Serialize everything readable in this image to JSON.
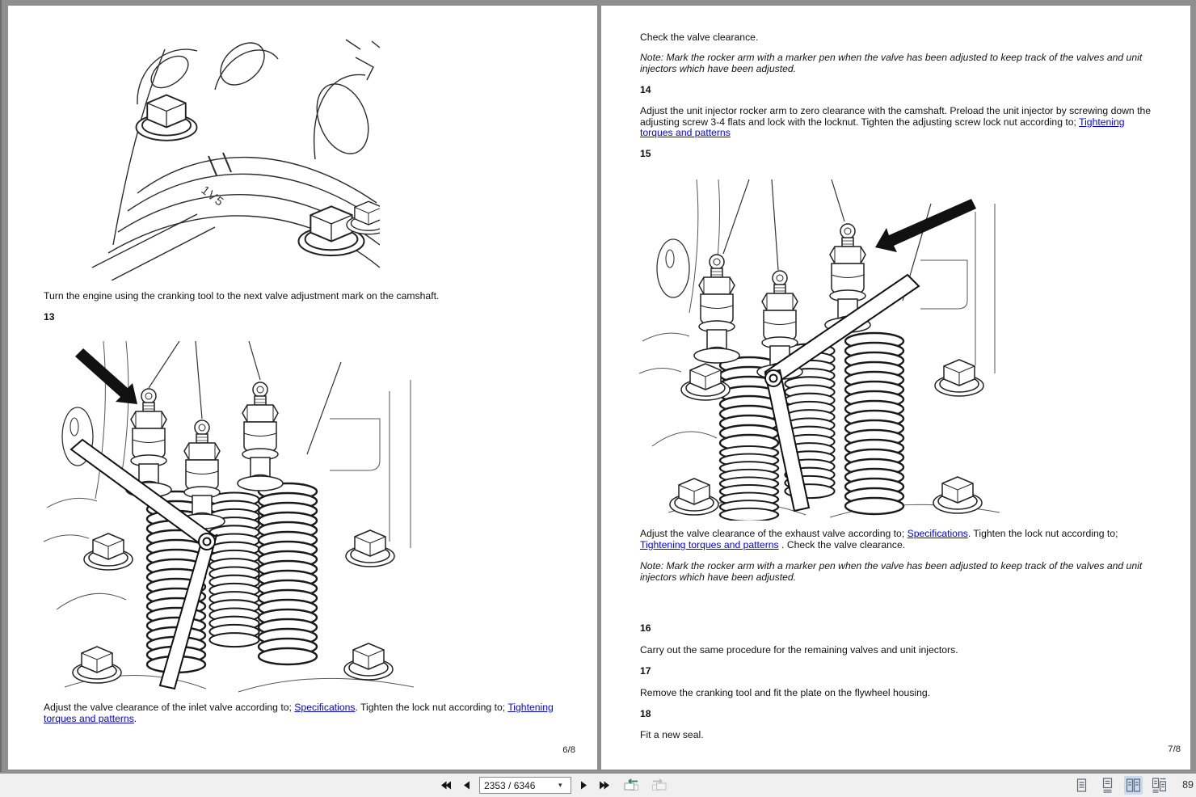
{
  "left_page": {
    "illustration_camshaft": {
      "mark_label": "1V5"
    },
    "para_turn_engine": "Turn the engine using the cranking tool to the next valve adjustment mark on the camshaft.",
    "step_13": "13",
    "para_adjust": {
      "prefix": "Adjust the valve clearance of the inlet valve according to; ",
      "link_specifications": "Specifications",
      "mid": ". Tighten the lock nut according to; ",
      "link_tightening": "Tightening torques and patterns",
      "suffix": "."
    },
    "page_number": "6/8"
  },
  "right_page": {
    "para_check": "Check the valve clearance.",
    "note_marker": "Note: Mark the rocker arm with a marker pen when the valve has been adjusted to keep track of the valves and unit injectors which have been adjusted.",
    "step_14": "14",
    "para_14": {
      "prefix": "Adjust the unit injector rocker arm to zero clearance with the camshaft. Preload the unit injector by screwing down the adjusting screw 3-4 flats and lock with the locknut. Tighten the adjusting screw lock nut according to; ",
      "link_tightening": "Tightening torques and patterns"
    },
    "step_15": "15",
    "para_15": {
      "prefix": "Adjust the valve clearance of the exhaust valve according to; ",
      "link_specifications": "Specifications",
      "mid": ". Tighten the lock nut according to; ",
      "link_tightening": "Tightening torques and patterns",
      "suffix": " . Check the valve clearance."
    },
    "note_marker_2": "Note: Mark the rocker arm with a marker pen when the valve has been adjusted to keep track of the valves and unit injectors which have been adjusted.",
    "step_16": "16",
    "para_16": "Carry out the same procedure for the remaining valves and unit injectors.",
    "step_17": "17",
    "para_17": "Remove the cranking tool and fit the plate on the flywheel housing.",
    "step_18": "18",
    "para_18": "Fit a new seal.",
    "page_number": "7/8"
  },
  "toolbar": {
    "page_input_value": "2353 / 6346",
    "caret": "▾",
    "zoom_level": "89",
    "icons": {
      "first_page": "first-page-icon",
      "prev_page": "previous-page-icon",
      "next_page": "next-page-icon",
      "last_page": "last-page-icon",
      "history_back": "navigate-back-icon",
      "history_forward": "navigate-forward-icon",
      "layout_single": "single-page-layout-icon",
      "layout_continuous": "continuous-layout-icon",
      "layout_facing": "facing-pages-layout-icon",
      "layout_book": "book-view-layout-icon"
    },
    "colors": {
      "accent_back_arrow": "#2f7d72",
      "active_layout_bg": "#c9daf0"
    }
  }
}
